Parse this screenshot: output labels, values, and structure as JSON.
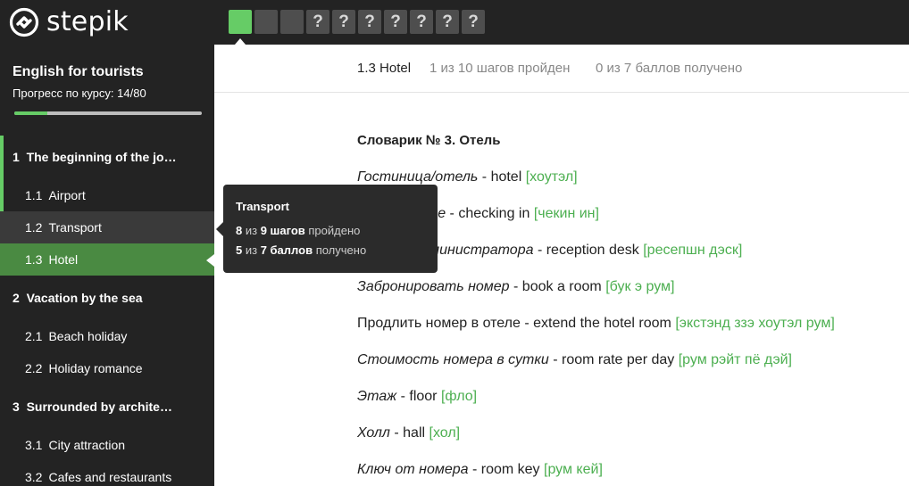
{
  "brand": {
    "name": "stepik"
  },
  "steps_bar": {
    "items": [
      {
        "label": "",
        "state": "done",
        "current": true
      },
      {
        "label": "",
        "state": "visited"
      },
      {
        "label": "",
        "state": "visited"
      },
      {
        "label": "?",
        "state": "quiz"
      },
      {
        "label": "?",
        "state": "quiz"
      },
      {
        "label": "?",
        "state": "quiz"
      },
      {
        "label": "?",
        "state": "quiz"
      },
      {
        "label": "?",
        "state": "quiz"
      },
      {
        "label": "?",
        "state": "quiz"
      },
      {
        "label": "?",
        "state": "quiz"
      }
    ]
  },
  "sidebar": {
    "course_title": "English for tourists",
    "progress_label": "Прогресс по курсу:  14/80",
    "progress_fraction": 0.175,
    "sections": [
      {
        "number": "1",
        "title": "The beginning of the jour…",
        "lessons": [
          {
            "number": "1.1",
            "title": "Airport"
          },
          {
            "number": "1.2",
            "title": "Transport",
            "state": "hover"
          },
          {
            "number": "1.3",
            "title": "Hotel",
            "state": "active"
          }
        ]
      },
      {
        "number": "2",
        "title": "Vacation by the sea",
        "lessons": [
          {
            "number": "2.1",
            "title": "Beach holiday"
          },
          {
            "number": "2.2",
            "title": "Holiday romance"
          }
        ]
      },
      {
        "number": "3",
        "title": "Surrounded by architectur…",
        "lessons": [
          {
            "number": "3.1",
            "title": "City attraction"
          },
          {
            "number": "3.2",
            "title": "Cafes and restaurants"
          }
        ]
      }
    ]
  },
  "header": {
    "lesson": "1.3 Hotel",
    "steps_status": "1 из 10 шагов пройден",
    "points_status": "0 из 7 баллов  получено"
  },
  "tooltip": {
    "title": "Transport",
    "steps_done": "8",
    "steps_sep": " из ",
    "steps_total": "9 шагов",
    "steps_suffix": " пройдено",
    "points_done": "5",
    "points_sep": " из ",
    "points_total": "7 баллов",
    "points_suffix": " получено"
  },
  "content": {
    "title": "Словарик № 3. Отель",
    "vocab": [
      {
        "ru": "Гостиница/отель",
        "en": " - hotel ",
        "tr": "[хоутэл]"
      },
      {
        "ru": "Оформление",
        "en": " - checking in ",
        "tr": "[чекин ин]"
      },
      {
        "ru": "Стойка администратора",
        "en": " - reception desk ",
        "tr": "[ресепшн дэск]"
      },
      {
        "ru": "Забронировать номер",
        "en": " - book a room ",
        "tr": "[бук э рум]"
      },
      {
        "ru": "Продлить номер в отеле",
        "en": " - extend the hotel room ",
        "tr": "[экстэнд ззэ хоутэл рум]",
        "plain": true
      },
      {
        "ru": "Стоимость номера в сутки",
        "en": " - room rate per day ",
        "tr": "[рум рэйт пё дэй]"
      },
      {
        "ru": "Этаж",
        "en": " - floor ",
        "tr": "[фло]"
      },
      {
        "ru": "Холл",
        "en": " - hall ",
        "tr": "[хол]"
      },
      {
        "ru": "Ключ от номера",
        "en": " - room key ",
        "tr": "[рум кей]"
      }
    ]
  },
  "colors": {
    "accent": "#66cc66",
    "active_lesson": "#4a8a42",
    "transcription": "#4caf50",
    "dark": "#232323"
  }
}
